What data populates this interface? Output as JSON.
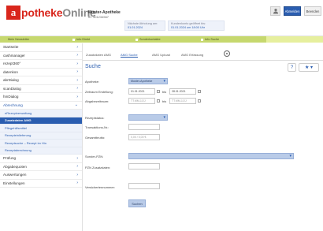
{
  "header": {
    "logo_prefix": "a",
    "logo_text": "potheke",
    "logo_suffix": "Online",
    "pharmacy_name": "Muster-Apotheke",
    "pharmacy_id": "IK: 301234567",
    "info1_line1": "Nächste Abholung am:",
    "info1_line2": "01.01.2024",
    "info2_line1": "Kundenkonto geöffnet bis:",
    "info2_line2": "01.01.2024 um 18:00 Uhr",
    "abmelden_label": "Abmelden",
    "beenden_label": "Beenden",
    "help_icon": "person-icon"
  },
  "topnav": {
    "items": [
      "Mein Newsletter",
      "Info Direkt",
      "Sonderkontakte",
      "Info Suche"
    ]
  },
  "sidebar": {
    "items": [
      {
        "label": "Startseite"
      },
      {
        "label": "cashmanager"
      },
      {
        "label": "rezept360°"
      },
      {
        "label": "datenkon"
      },
      {
        "label": "abrDialog"
      },
      {
        "label": "scanDialog"
      },
      {
        "label": "hmDialog"
      },
      {
        "label": "Abrechnung"
      }
    ],
    "subitems": [
      {
        "label": "eRezeptverwaltung"
      },
      {
        "label": "Zusatzdaten AMG"
      },
      {
        "label": "Pflegehilfsmittel"
      },
      {
        "label": "Rezepteinlieferung"
      },
      {
        "label": "Rezeptsuche – Rezept im Hin"
      },
      {
        "label": "Rezeptabrechnung"
      }
    ],
    "items_bottom": [
      {
        "label": "Prüfung"
      },
      {
        "label": "Abgabequoten"
      },
      {
        "label": "Auswertungen"
      },
      {
        "label": "Einstellungen"
      }
    ]
  },
  "tabs": [
    "Zusatzdaten AMG",
    "AMG Suche",
    "AMG Upload",
    "AMG Erfassung"
  ],
  "main": {
    "title": "Suche",
    "apotheke_label": "Apotheke:",
    "apotheke_value": "Muster-Apotheke",
    "zeitraum_label": "Zeitraum Erstellung:",
    "zeitraum_from": "01.01.2021",
    "zeitraum_to": "28.01.2021",
    "abgabe_label": "Abgabezeitraum:",
    "abgabe_from_placeholder": "TT.MM.JJJJ",
    "abgabe_to_placeholder": "TT.MM.JJJJ",
    "bis_label": "bis",
    "status_label": "Rezeptstatus:",
    "transaktion_label": "Transaktions-Nr.:",
    "gesamtbrutto_label": "Gesamtbrutto:",
    "gesamtbrutto_placeholder": "0,00 / 0,00 €",
    "sonder_label": "Sonder-PZN:",
    "pzn_label": "PZN Zusatzdaten:",
    "vers_label": "Versichertennummer:",
    "search_label": "Suchen"
  }
}
